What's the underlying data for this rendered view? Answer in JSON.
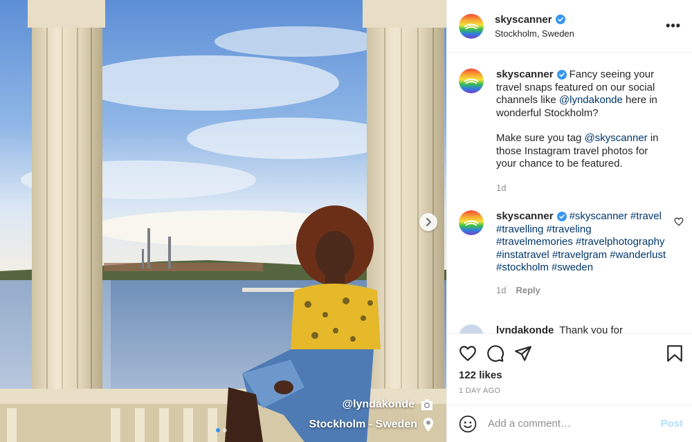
{
  "photo": {
    "tag_user": "@lyndakonde",
    "tag_location": "Stockholm - Sweden",
    "carousel_count": 2,
    "carousel_active": 1
  },
  "post": {
    "username": "skyscanner",
    "location": "Stockholm, Sweden",
    "more_label": "•••"
  },
  "caption": {
    "username": "skyscanner",
    "text_1": "Fancy seeing your travel snaps featured on our social channels like ",
    "mention_1": "@lyndakonde",
    "text_2": " here in wonderful Stockholm?",
    "text_3": "Make sure you tag ",
    "mention_2": "@skyscanner",
    "text_4": " in those Instagram travel photos for your chance to be featured.",
    "time": "1d"
  },
  "comment_hashtags": {
    "username": "skyscanner",
    "tags": "#skyscanner #travel #travelling #traveling #travelmemories #travelphotography #instatravel #travelgram #wanderlust #stockholm #sweden",
    "time": "1d",
    "reply_label": "Reply"
  },
  "comment_partial": {
    "username": "lyndakonde",
    "text": "Thank you for"
  },
  "engagement": {
    "likes": "122 likes",
    "date": "1 DAY AGO"
  },
  "composer": {
    "placeholder": "Add a comment…",
    "post_label": "Post"
  },
  "colors": {
    "verified": "#3897f0",
    "link": "#00376b",
    "muted": "#8e8e8e",
    "post_disabled": "#b2dffc"
  }
}
